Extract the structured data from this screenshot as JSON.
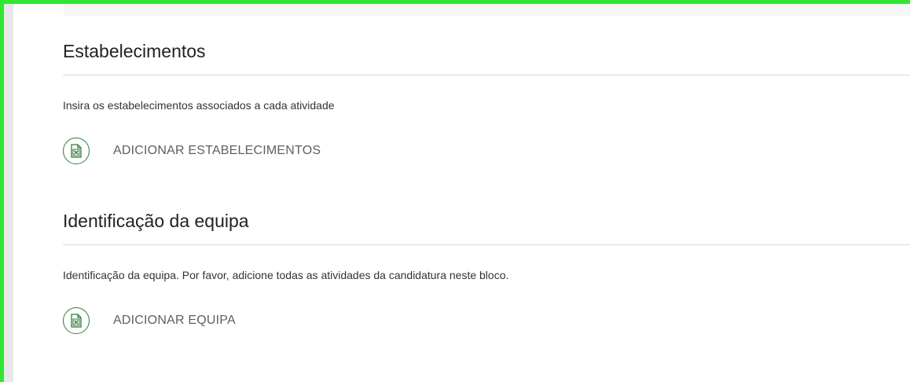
{
  "sections": [
    {
      "title": "Estabelecimentos",
      "description": "Insira os estabelecimentos associados a cada atividade",
      "action_label": "ADICIONAR ESTABELECIMENTOS",
      "action_icon": "excel-file-icon"
    },
    {
      "title": "Identificação da equipa",
      "description": "Identificação da equipa. Por favor, adicione todas as atividades da candidatura neste bloco.",
      "action_label": "ADICIONAR EQUIPA",
      "action_icon": "excel-file-icon"
    }
  ],
  "colors": {
    "frame_highlight": "#33e633",
    "icon_green": "#2f7d3b",
    "action_text": "#5f5f5f"
  }
}
